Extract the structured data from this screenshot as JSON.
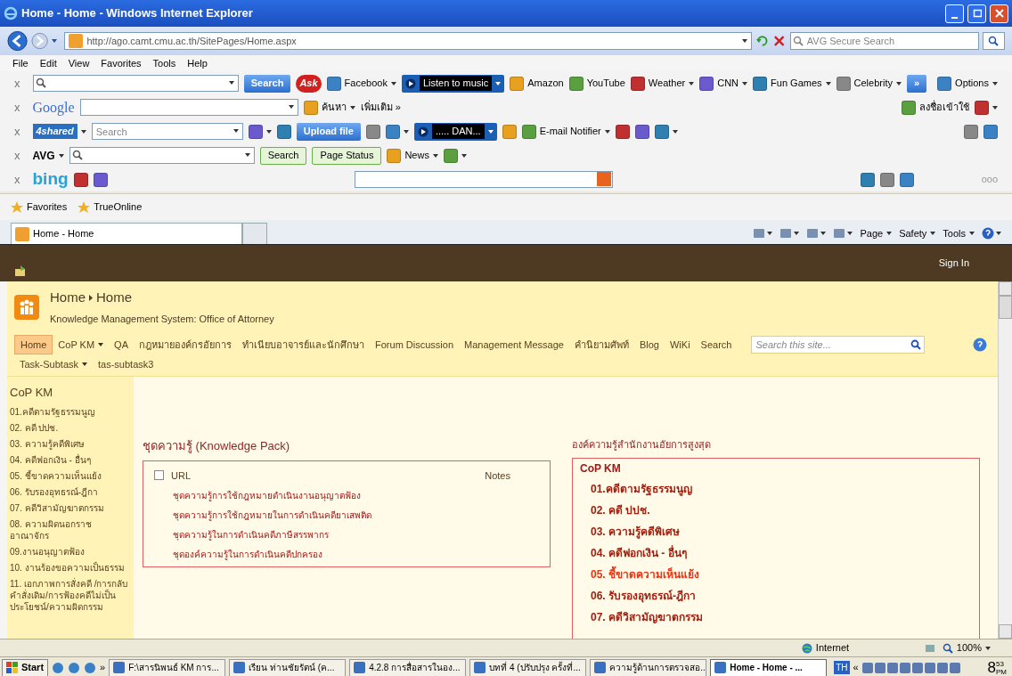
{
  "window": {
    "title": "Home - Home - Windows Internet Explorer"
  },
  "address_bar": {
    "url": "http://ago.camt.cmu.ac.th/SitePages/Home.aspx",
    "search_placeholder": "AVG Secure Search"
  },
  "menu_bar": [
    "File",
    "Edit",
    "View",
    "Favorites",
    "Tools",
    "Help"
  ],
  "toolbars": [
    {
      "left": [
        {
          "kind": "close",
          "label": "x"
        },
        {
          "kind": "field",
          "dropdown": true
        },
        {
          "kind": "button",
          "label": "Search"
        },
        {
          "kind": "logo",
          "label": "Ask"
        },
        {
          "kind": "link",
          "label": "Facebook",
          "icon": true,
          "dropdown": true
        },
        {
          "kind": "player",
          "label": "Listen to music"
        },
        {
          "kind": "link",
          "label": "Amazon",
          "icon": true,
          "dropdown": false
        },
        {
          "kind": "link",
          "label": "YouTube",
          "icon": true,
          "dropdown": false
        },
        {
          "kind": "link",
          "label": "Weather",
          "icon": true,
          "dropdown": true
        },
        {
          "kind": "link",
          "label": "CNN",
          "icon": true,
          "dropdown": true
        },
        {
          "kind": "link",
          "label": "Fun Games",
          "icon": true,
          "dropdown": true
        },
        {
          "kind": "link",
          "label": "Celebrity",
          "icon": true,
          "dropdown": true
        },
        {
          "kind": "button",
          "label": "»"
        }
      ],
      "right": [
        {
          "kind": "link",
          "label": "Options",
          "icon": true,
          "dropdown": true
        }
      ]
    },
    {
      "left": [
        {
          "kind": "close",
          "label": "x"
        },
        {
          "kind": "logo",
          "label": "Google"
        },
        {
          "kind": "field",
          "dropdown": true
        },
        {
          "kind": "link",
          "label": "ค้นหา",
          "icon": true,
          "dropdown": true
        },
        {
          "kind": "link",
          "label": "เพิ่มเติม »",
          "icon": false,
          "dropdown": false
        }
      ],
      "right": [
        {
          "kind": "link",
          "label": "ลงชื่อเข้าใช้",
          "icon": true,
          "dropdown": false
        },
        {
          "kind": "icon",
          "dropdown": true
        }
      ]
    },
    {
      "left": [
        {
          "kind": "close",
          "label": "x"
        },
        {
          "kind": "logo",
          "label": "4shared",
          "dropdown": true
        },
        {
          "kind": "field",
          "placeholder": "Search",
          "dropdown": true
        },
        {
          "kind": "icon",
          "dropdown": true
        },
        {
          "kind": "icon",
          "dropdown": false
        },
        {
          "kind": "button",
          "label": "Upload file"
        },
        {
          "kind": "icon",
          "dropdown": false
        },
        {
          "kind": "icon",
          "dropdown": true
        },
        {
          "kind": "player",
          "label": "..... DAN..."
        },
        {
          "kind": "icon",
          "dropdown": false
        },
        {
          "kind": "link",
          "label": "E-mail Notifier",
          "icon": true,
          "dropdown": true
        },
        {
          "kind": "icon",
          "dropdown": false
        },
        {
          "kind": "icon",
          "dropdown": false
        },
        {
          "kind": "icon",
          "dropdown": true
        }
      ],
      "right": [
        {
          "kind": "icon",
          "dropdown": false
        },
        {
          "kind": "icon",
          "dropdown": false
        }
      ]
    },
    {
      "left": [
        {
          "kind": "close",
          "label": "x"
        },
        {
          "kind": "logo",
          "label": "AVG",
          "dropdown": true
        },
        {
          "kind": "field",
          "dropdown": true
        },
        {
          "kind": "button",
          "label": "Search"
        },
        {
          "kind": "button",
          "label": "Page Status"
        },
        {
          "kind": "link",
          "label": "News",
          "icon": true,
          "dropdown": true
        },
        {
          "kind": "icon",
          "dropdown": true
        }
      ]
    },
    {
      "left": [
        {
          "kind": "close",
          "label": "x"
        },
        {
          "kind": "logo",
          "label": "bing"
        },
        {
          "kind": "icon",
          "dropdown": false
        },
        {
          "kind": "icon",
          "dropdown": false
        },
        {
          "kind": "field"
        },
        {
          "kind": "icon",
          "dropdown": false
        },
        {
          "kind": "icon",
          "dropdown": false
        },
        {
          "kind": "icon",
          "dropdown": false
        }
      ],
      "right": [
        {
          "kind": "text",
          "label": "ooo"
        }
      ]
    }
  ],
  "favorites_bar": [
    "Favorites",
    "TrueOnline"
  ],
  "tabs": [
    {
      "label": "Home - Home",
      "selected": true
    }
  ],
  "command_bar": [
    "Page",
    "Safety",
    "Tools"
  ],
  "site": {
    "sign_in": "Sign In",
    "breadcrumb": [
      "Home",
      "Home"
    ],
    "subtitle": "Knowledge Management System: Office of Attorney",
    "top_nav": [
      {
        "label": "Home",
        "selected": true,
        "dropdown": false
      },
      {
        "label": "CoP KM",
        "selected": false,
        "dropdown": true
      },
      {
        "label": "QA",
        "selected": false,
        "dropdown": false
      },
      {
        "label": "กฎหมายองค์กรอัยการ",
        "selected": false,
        "dropdown": false
      },
      {
        "label": "ทำเนียบอาจารย์และนักศึกษา",
        "selected": false,
        "dropdown": false
      },
      {
        "label": "Forum Discussion",
        "selected": false,
        "dropdown": false
      },
      {
        "label": "Management Message",
        "selected": false,
        "dropdown": false
      },
      {
        "label": "คำนิยามศัพท์",
        "selected": false,
        "dropdown": false
      },
      {
        "label": "Blog",
        "selected": false,
        "dropdown": false
      },
      {
        "label": "WiKi",
        "selected": false,
        "dropdown": false
      },
      {
        "label": "Search",
        "selected": false,
        "dropdown": false
      },
      {
        "label": "Task-Subtask",
        "selected": false,
        "dropdown": true
      },
      {
        "label": "tas-subtask3",
        "selected": false,
        "dropdown": false
      }
    ],
    "search_placeholder": "Search this site...",
    "quick_launch": {
      "heading": "CoP KM",
      "items": [
        "01.คดีตามรัฐธรรมนูญ",
        "02. คดี ปปช.",
        "03. ความรู้คดีพิเศษ",
        "04. คดีฟอกเงิน - อื่นๆ",
        "05. ชี้ขาดความเห็นแย้ง",
        "06. รับรองอุทธรณ์-ฎีกา",
        "07. คดีวิสามัญฆาตกรรม",
        "08. ความผิดนอกราชอาณาจักร",
        "09.งานอนุญาตฟ้อง",
        "10. งานร้องขอความเป็นธรรม",
        "11. เอกภาพการสั่งคดี /การกลับคำสั่งเดิม/การฟ้องคดีไม่เป็นประโยชน์/ความผิดกรรม"
      ]
    },
    "knowledge_pack": {
      "title": "ชุดความรู้ (Knowledge Pack)",
      "columns": [
        "URL",
        "Notes"
      ],
      "select_all_checked": false,
      "rows": [
        "ชุดความรู้การใช้กฎหมายดำเนินงานอนุญาตฟ้อง",
        "ชุดความรู้การใช้กฎหมายในการดำเนินคดียาเสพติด",
        "ชุดความรู้ในการดำเนินคดีภาษีสรรพากร",
        "ชุดองค์ความรู้ในการดำเนินคดีปกครอง"
      ]
    },
    "ago_panel": {
      "title": "องค์ความรู้สำนักงานอัยการสูงสุด",
      "heading": "CoP KM",
      "items": [
        {
          "label": "01.คดีตามรัฐธรรมนูญ",
          "hovered": false
        },
        {
          "label": "02. คดี ปปช.",
          "hovered": false
        },
        {
          "label": "03. ความรู้คดีพิเศษ",
          "hovered": false
        },
        {
          "label": "04. คดีฟอกเงิน - อื่นๆ",
          "hovered": false
        },
        {
          "label": "05. ชี้ขาดความเห็นแย้ง",
          "hovered": true
        },
        {
          "label": "06. รับรองอุทธรณ์-ฎีกา",
          "hovered": false
        },
        {
          "label": "07. คดีวิสามัญฆาตกรรม",
          "hovered": false
        }
      ]
    }
  },
  "status_bar": {
    "zone": "Internet",
    "zoom": "100%"
  },
  "taskbar": {
    "start": "Start",
    "chevron": "»",
    "items": [
      {
        "label": "F:\\สารนิพนธ์ KM การ...",
        "selected": false
      },
      {
        "label": "เรียน ท่านชัยรัตน์ (ค...",
        "selected": false
      },
      {
        "label": "4.2.8 การสื่อสารในอง...",
        "selected": false
      },
      {
        "label": "บทที่ 4 (ปรับปรุง ครั้งที่...",
        "selected": false
      },
      {
        "label": "ความรู้ด้านการตรวจสอ...",
        "selected": false
      },
      {
        "label": "Home - Home - ...",
        "selected": true
      }
    ],
    "language": "TH",
    "tray_chevron": "«",
    "clock": {
      "hour": "8",
      "minutes": "53",
      "period": "PM"
    }
  }
}
